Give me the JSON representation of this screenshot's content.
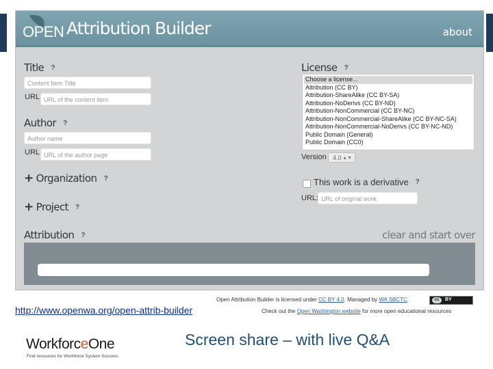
{
  "header": {
    "logo_text": "OPEN",
    "app_title": "Attribution Builder",
    "about_label": "about"
  },
  "left": {
    "title_label": "Title",
    "title_placeholder": "Content Item Title",
    "title_url_label": "URL:",
    "title_url_placeholder": "URL of the content item",
    "author_label": "Author",
    "author_placeholder": "Author name",
    "author_url_label": "URL:",
    "author_url_placeholder": "URL of the author page",
    "organization_label": "Organization",
    "project_label": "Project",
    "plus_symbol": "+",
    "help_symbol": "?"
  },
  "right": {
    "license_label": "License",
    "license_options": [
      "Choose a license...",
      "Attribution (CC BY)",
      "Attribution-ShareAlike (CC BY-SA)",
      "Attribution-NoDerivs (CC BY-ND)",
      "Attribution-NonCommercial (CC BY-NC)",
      "Attribution-NonCommercial-ShareAlike (CC BY-NC-SA)",
      "Attribution-NonCommercial-NoDerivs (CC BY-NC-ND)",
      "Public Domain (General)",
      "Public Domain (CC0)"
    ],
    "version_label": "Version",
    "version_value": "4.0",
    "derivative_label": "This work is a derivative",
    "derivative_checked": false,
    "derivative_url_label": "URL:",
    "derivative_url_placeholder": "URL of original work"
  },
  "attribution": {
    "label": "Attribution",
    "clear_label": "clear and start over"
  },
  "footer": {
    "line1_prefix": "Open Attribution Builder is licensed under ",
    "line1_license": "CC BY 4.0",
    "line1_middle": ". Managed by ",
    "line1_org": "WA SBCTC",
    "line1_end": ".",
    "line2_prefix": "Check out the ",
    "line2_link": "Open Washington website",
    "line2_suffix": " for more open educational resources",
    "cc_badge_left": "cc",
    "cc_badge_right": "BY"
  },
  "slide": {
    "url": "http://www.openwa.org/open-attrib-builder",
    "caption": "Screen share – with live Q&A",
    "logo_name_part1": "Workforc",
    "logo_name_mark": "e",
    "logo_name_part2": "One",
    "logo_tagline": "Find resources for Workforce System Success"
  },
  "colors": {
    "header_bg": "#7fa6b2",
    "panel_bg": "#d3d4d5",
    "attribution_box": "#818d93",
    "caption_color": "#1f4e79",
    "logo_accent": "#d8592a"
  }
}
